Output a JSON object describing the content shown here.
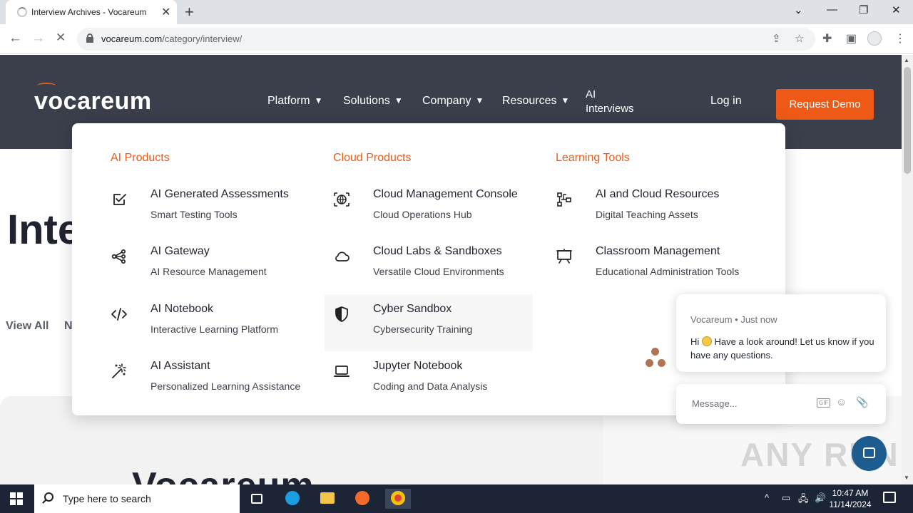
{
  "browser": {
    "tab_title": "Interview Archives - Vocareum",
    "tab_close": "✕",
    "new_tab": "+",
    "url_host": "vocareum.com",
    "url_path": "/category/interview/",
    "controls": {
      "dropdown": "⌄",
      "minimize": "—",
      "restore": "❐",
      "close": "✕"
    },
    "nav": {
      "back": "←",
      "forward": "→",
      "stop": "✕"
    }
  },
  "site": {
    "logo": "vocareum",
    "nav": [
      {
        "label": "Platform"
      },
      {
        "label": "Solutions"
      },
      {
        "label": "Company"
      },
      {
        "label": "Resources"
      }
    ],
    "nav_ai_line1": "AI",
    "nav_ai_line2": "Interviews",
    "login": "Log in",
    "demo": "Request Demo",
    "chevron": "❯",
    "hero_title": "Inte",
    "filter_all": "View All",
    "filter_next": "N",
    "card_logo": "Vocareum",
    "accent_color": "#ee5a16"
  },
  "menu": {
    "columns": [
      {
        "heading": "AI Products",
        "items": [
          {
            "name": "AI Generated Assessments",
            "desc": "Smart Testing Tools",
            "icon": "checkbox-icon"
          },
          {
            "name": "AI Gateway",
            "desc": "AI Resource Management",
            "icon": "share-nodes-icon"
          },
          {
            "name": "AI Notebook",
            "desc": "Interactive Learning Platform",
            "icon": "code-icon"
          },
          {
            "name": "AI Assistant",
            "desc": "Personalized Learning Assistance",
            "icon": "magic-wand-icon"
          }
        ]
      },
      {
        "heading": "Cloud Products",
        "items": [
          {
            "name": "Cloud Management Console",
            "desc": "Cloud Operations Hub",
            "icon": "network-globe-icon"
          },
          {
            "name": "Cloud Labs & Sandboxes",
            "desc": "Versatile Cloud Environments",
            "icon": "cloud-icon"
          },
          {
            "name": "Cyber Sandbox",
            "desc": "Cybersecurity Training",
            "icon": "shield-icon"
          },
          {
            "name": "Jupyter Notebook",
            "desc": "Coding and Data Analysis",
            "icon": "laptop-icon"
          }
        ]
      },
      {
        "heading": "Learning Tools",
        "items": [
          {
            "name": "AI and Cloud Resources",
            "desc": "Digital Teaching Assets",
            "icon": "resources-icon"
          },
          {
            "name": "Classroom Management",
            "desc": "Educational Administration Tools",
            "icon": "presentation-board-icon"
          }
        ]
      }
    ]
  },
  "chat": {
    "sender": "Vocareum",
    "time": "Just now",
    "separator": " • ",
    "msg_hi": "Hi",
    "msg_rest": "Have a look around! Let us know if you have any questions.",
    "input_placeholder": "Message...",
    "gif_label": "GIF",
    "smile": "☺",
    "attach": "📎"
  },
  "watermark": "ANY RUN",
  "taskbar": {
    "search_placeholder": "Type here to search",
    "time": "10:47 AM",
    "date": "11/14/2024",
    "tray_chevron": "^"
  }
}
